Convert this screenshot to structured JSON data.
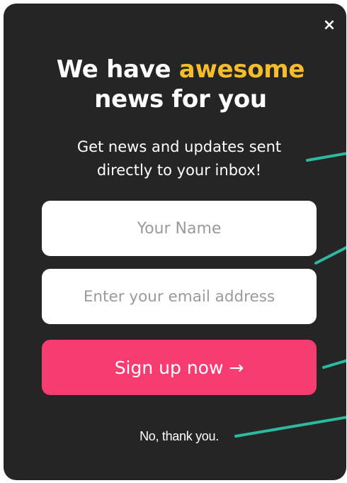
{
  "popup": {
    "close_label": "×",
    "headline": {
      "prefix": "We have ",
      "highlight": "awesome",
      "line2": "news for you"
    },
    "subtext": {
      "line1": "Get news and updates sent",
      "line2": "directly to your inbox!"
    },
    "form": {
      "name_placeholder": "Your Name",
      "email_placeholder": "Enter your email address",
      "submit_label": "Sign up now →"
    },
    "decline_label": "No, thank you."
  },
  "colors": {
    "background": "#252525",
    "headline_highlight": "#f5bd2a",
    "button": "#f63c71",
    "accent_lines": "#2bb9a0"
  },
  "icons": {
    "close": "close-icon",
    "arrow": "arrow-right-icon"
  }
}
